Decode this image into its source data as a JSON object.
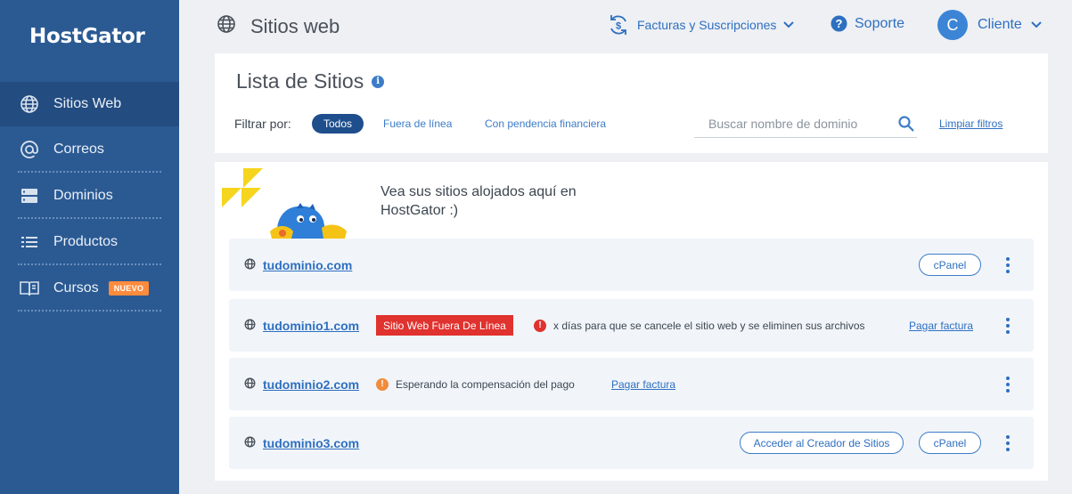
{
  "brand": {
    "logo_text": "HostGator"
  },
  "sidebar": {
    "items": [
      {
        "label": "Sitios Web",
        "icon": "globe-icon",
        "active": true
      },
      {
        "label": "Correos",
        "icon": "at-icon"
      },
      {
        "label": "Dominios",
        "icon": "server-icon"
      },
      {
        "label": "Productos",
        "icon": "list-icon"
      },
      {
        "label": "Cursos",
        "icon": "book-icon",
        "badge": "NUEVO"
      }
    ]
  },
  "header": {
    "title": "Sitios web",
    "billing_label": "Facturas y Suscripciones",
    "support_label": "Soporte",
    "user_initial": "C",
    "user_label": "Cliente"
  },
  "filters": {
    "title": "Lista de Sitios",
    "label": "Filtrar por:",
    "chips": [
      "Todos",
      "Fuera de línea",
      "Con pendencia financiera"
    ],
    "active_chip": "Todos",
    "search_placeholder": "Buscar nombre de dominio",
    "clear_label": "Limpiar filtros"
  },
  "sites": {
    "promo_text": "Vea sus sitios alojados aquí en HostGator :)",
    "rows": [
      {
        "domain": "tudominio.com",
        "cpanel": "cPanel"
      },
      {
        "domain": "tudominio1.com",
        "status": "Sitio Web Fuera De Línea",
        "message": "x días para que se cancele el sitio web y se eliminen sus archivos",
        "link": "Pagar factura"
      },
      {
        "domain": "tudominio2.com",
        "message": "Esperando la compensación del pago",
        "link": "Pagar factura"
      },
      {
        "domain": "tudominio3.com",
        "builder": "Acceder al Creador de Sitios",
        "cpanel": "cPanel"
      }
    ]
  },
  "colors": {
    "sidebar_bg": "#2b5a93",
    "link": "#2e6fc0",
    "offline_red": "#e0322e",
    "warning_orange": "#f08c3c",
    "badge_orange": "#ff8b3d"
  }
}
